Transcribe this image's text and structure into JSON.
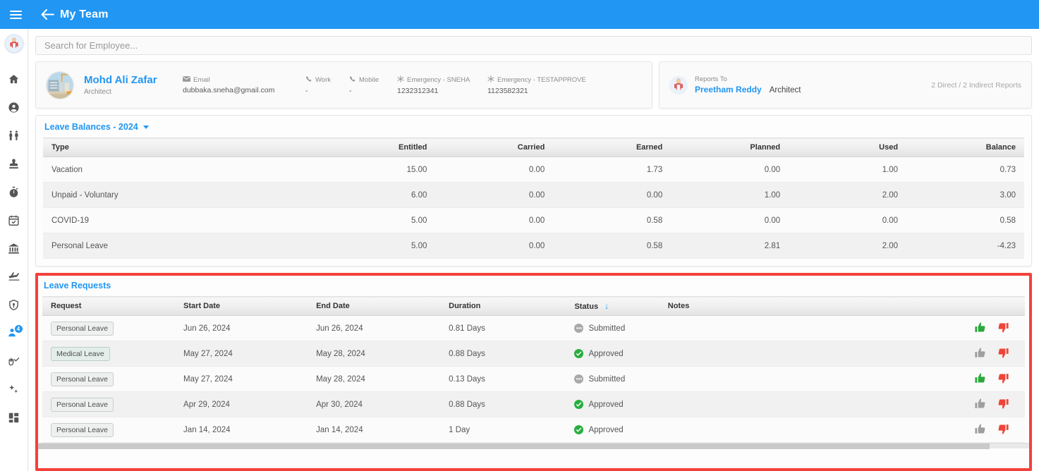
{
  "topbar": {
    "menu_icon": "hamburger-icon",
    "back_icon": "back-arrow-icon",
    "title": "My Team"
  },
  "sidebar": {
    "avatar_alt": "user-avatar",
    "items": [
      {
        "icon": "home-icon",
        "label": "Home",
        "active": false
      },
      {
        "icon": "person-icon",
        "label": "Profile",
        "active": false
      },
      {
        "icon": "people-icon",
        "label": "People",
        "active": false
      },
      {
        "icon": "stamp-icon",
        "label": "Approvals",
        "active": false
      },
      {
        "icon": "stopwatch-icon",
        "label": "Time",
        "active": false
      },
      {
        "icon": "calendar-check-icon",
        "label": "Calendar",
        "active": false
      },
      {
        "icon": "bank-icon",
        "label": "Finance",
        "active": false
      },
      {
        "icon": "plane-icon",
        "label": "Travel",
        "active": false
      },
      {
        "icon": "shield-pin-icon",
        "label": "Safety",
        "active": false
      },
      {
        "icon": "my-team-icon",
        "label": "My Team",
        "active": true,
        "badge": "4"
      },
      {
        "icon": "hand-check-icon",
        "label": "Tasks",
        "active": false
      },
      {
        "icon": "sparkles-icon",
        "label": "Insights",
        "active": false
      },
      {
        "icon": "grid-apps-icon",
        "label": "Apps",
        "active": false
      }
    ]
  },
  "search": {
    "placeholder": "Search for Employee...",
    "value": ""
  },
  "profile": {
    "avatar_alt": "employee-photo",
    "name": "Mohd Ali Zafar",
    "title": "Architect",
    "contacts": [
      {
        "icon": "email-icon",
        "label": "Email",
        "value": "dubbaka.sneha@gmail.com"
      },
      {
        "icon": "phone-icon",
        "label": "Work",
        "value": "-"
      },
      {
        "icon": "phone-icon",
        "label": "Mobile",
        "value": "-"
      },
      {
        "icon": "emergency-icon",
        "label": "Emergency - SNEHA",
        "value": "1232312341"
      },
      {
        "icon": "emergency-icon",
        "label": "Emergency - TESTAPPROVE",
        "value": "1123582321"
      }
    ]
  },
  "reports_to": {
    "avatar_alt": "manager-photo",
    "label": "Reports To",
    "name": "Preetham Reddy",
    "role": "Architect",
    "count": "2 Direct / 2 Indirect Reports"
  },
  "leave_balances": {
    "title": "Leave Balances - 2024",
    "caret_icon": "chevron-down-icon",
    "columns": [
      "Type",
      "Entitled",
      "Carried",
      "Earned",
      "Planned",
      "Used",
      "Balance"
    ],
    "rows": [
      {
        "type": "Vacation",
        "entitled": "15.00",
        "carried": "0.00",
        "earned": "1.73",
        "planned": "0.00",
        "used": "1.00",
        "balance": "0.73"
      },
      {
        "type": "Unpaid - Voluntary",
        "entitled": "6.00",
        "carried": "0.00",
        "earned": "0.00",
        "planned": "1.00",
        "used": "2.00",
        "balance": "3.00"
      },
      {
        "type": "COVID-19",
        "entitled": "5.00",
        "carried": "0.00",
        "earned": "0.58",
        "planned": "0.00",
        "used": "0.00",
        "balance": "0.58"
      },
      {
        "type": "Personal Leave",
        "entitled": "5.00",
        "carried": "0.00",
        "earned": "0.58",
        "planned": "2.81",
        "used": "2.00",
        "balance": "-4.23"
      }
    ]
  },
  "leave_requests": {
    "title": "Leave Requests",
    "highlight_color": "#f4413a",
    "columns": [
      "Request",
      "Start Date",
      "End Date",
      "Duration",
      "Status",
      "Notes"
    ],
    "sorted_column": "Status",
    "sort_icon": "arrow-down-icon",
    "rows": [
      {
        "request": "Personal Leave",
        "request_type": "personal",
        "start": "Jun 26, 2024",
        "end": "Jun 26, 2024",
        "duration": "0.81 Days",
        "status": "Submitted",
        "status_kind": "submitted",
        "notes": "",
        "approve_enabled": true
      },
      {
        "request": "Medical Leave",
        "request_type": "medical",
        "start": "May 27, 2024",
        "end": "May 28, 2024",
        "duration": "0.88 Days",
        "status": "Approved",
        "status_kind": "approved",
        "notes": "",
        "approve_enabled": false
      },
      {
        "request": "Personal Leave",
        "request_type": "personal",
        "start": "May 27, 2024",
        "end": "May 28, 2024",
        "duration": "0.13 Days",
        "status": "Submitted",
        "status_kind": "submitted",
        "notes": "",
        "approve_enabled": true
      },
      {
        "request": "Personal Leave",
        "request_type": "personal",
        "start": "Apr 29, 2024",
        "end": "Apr 30, 2024",
        "duration": "0.88 Days",
        "status": "Approved",
        "status_kind": "approved",
        "notes": "",
        "approve_enabled": false
      },
      {
        "request": "Personal Leave",
        "request_type": "personal",
        "start": "Jan 14, 2024",
        "end": "Jan 14, 2024",
        "duration": "1 Day",
        "status": "Approved",
        "status_kind": "approved",
        "notes": "",
        "approve_enabled": false
      }
    ],
    "approve_icon": "thumbs-up-icon",
    "reject_icon": "thumbs-down-icon",
    "approve_color_active": "#2aa83c",
    "approve_color_inactive": "#9e9e9e",
    "reject_color": "#f04438"
  },
  "colors": {
    "accent": "#2196f3",
    "approved": "#27ae3f",
    "submitted": "#a9a9a9"
  }
}
